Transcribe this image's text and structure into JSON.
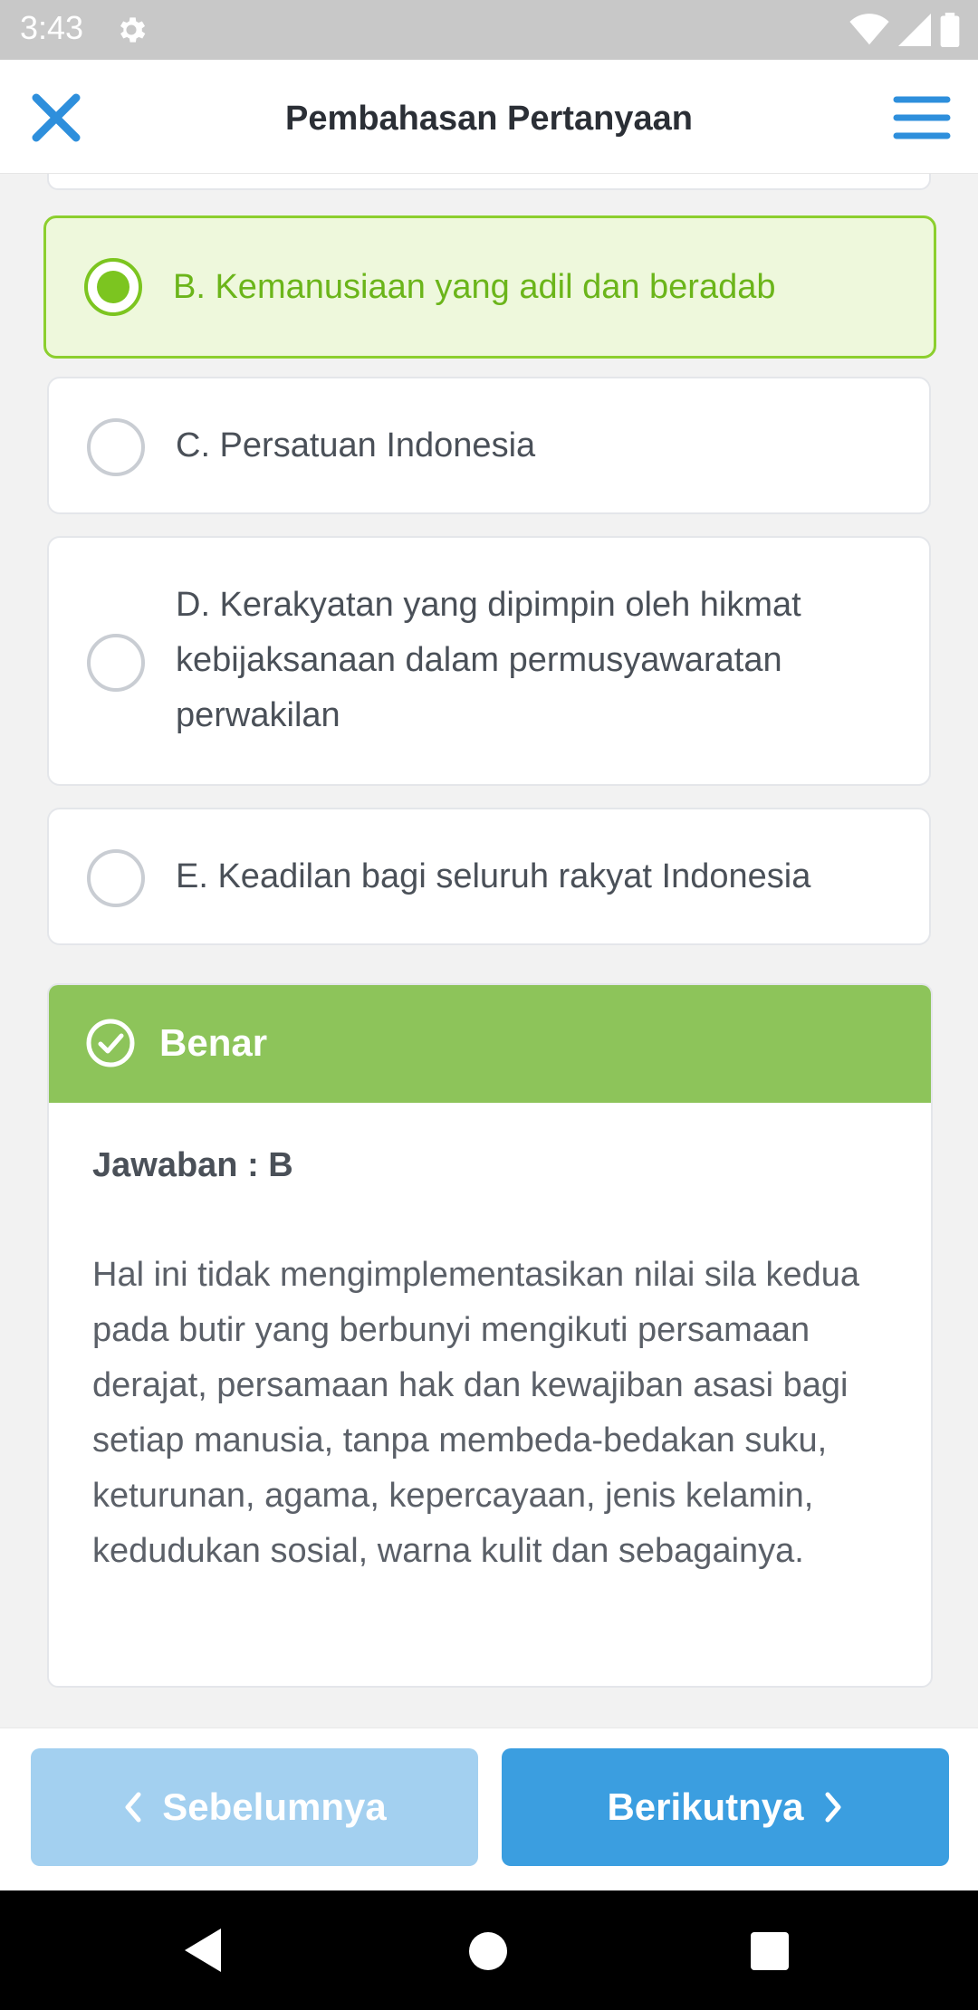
{
  "status_bar": {
    "time": "3:43"
  },
  "app_bar": {
    "title": "Pembahasan Pertanyaan"
  },
  "options": [
    {
      "label": "B. Kemanusiaan yang adil dan beradab",
      "selected": true
    },
    {
      "label": "C. Persatuan Indonesia",
      "selected": false
    },
    {
      "label": "D. Kerakyatan yang dipimpin oleh hikmat kebijaksanaan dalam permusyawaratan perwakilan",
      "selected": false
    },
    {
      "label": "E. Keadilan bagi seluruh rakyat Indonesia",
      "selected": false
    }
  ],
  "result": {
    "status": "Benar",
    "answer": "Jawaban : B",
    "explanation": "Hal ini tidak mengimplementasikan nilai sila kedua pada butir yang berbunyi mengikuti persamaan derajat, persamaan hak dan kewajiban asasi bagi setiap manusia, tanpa membeda-bedakan suku, keturunan, agama, kepercayaan, jenis kelamin, kedudukan sosial, warna kulit dan sebagainya."
  },
  "nav": {
    "prev_label": "Sebelumnya",
    "next_label": "Berikutnya"
  },
  "colors": {
    "accent_blue": "#3b9ee0",
    "correct_green": "#8dc45a",
    "selected_border": "#8ccf2e",
    "selected_bg": "#eef8dc"
  }
}
